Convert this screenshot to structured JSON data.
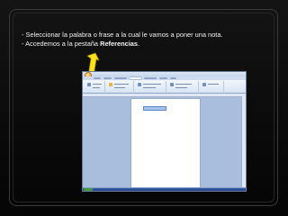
{
  "instructions": {
    "line1": "- Seleccionar la palabra o frase a la cual le vamos a poner una nota.",
    "line2_prefix": "- Accedemos a la pestaña ",
    "line2_bold": "Referencias",
    "line2_suffix": "."
  },
  "screenshot": {
    "ribbon_active_tab_index": 4
  },
  "colors": {
    "background": "#0b0b0b",
    "text": "#f2f2f2",
    "arrow_fill": "#ffe21a",
    "arrow_stroke": "#9a8a00",
    "ribbon": "#d7e3f4",
    "selection": "#a6c3ee"
  },
  "icons": {
    "arrow": "curved-up-arrow-icon",
    "office_button": "office-orb-icon"
  }
}
